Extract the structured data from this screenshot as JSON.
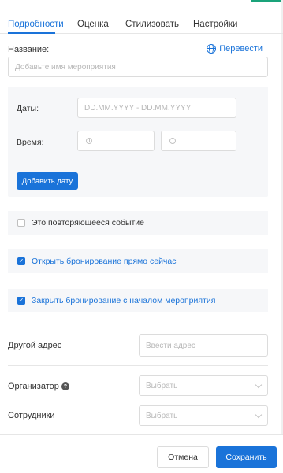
{
  "tabs": [
    {
      "label": "Подробности",
      "active": true
    },
    {
      "label": "Оценка",
      "active": false
    },
    {
      "label": "Стилизовать",
      "active": false
    },
    {
      "label": "Настройки",
      "active": false
    }
  ],
  "name_field": {
    "label": "Название:",
    "placeholder": "Добавьте имя мероприятия",
    "translate_label": "Перевести"
  },
  "dates": {
    "dates_label": "Даты:",
    "dates_placeholder": "DD.MM.YYYY - DD.MM.YYYY",
    "time_label": "Время:",
    "add_date_button": "Добавить дату"
  },
  "options": [
    {
      "label": "Это повторяющееся событие",
      "checked": false
    },
    {
      "label": "Открыть бронирование прямо сейчас",
      "checked": true
    },
    {
      "label": "Закрыть бронирование с началом мероприятия",
      "checked": true
    }
  ],
  "other_address": {
    "label": "Другой адрес",
    "placeholder": "Ввести адрес"
  },
  "organizer": {
    "label": "Организатор",
    "placeholder": "Выбрать"
  },
  "staff": {
    "label": "Сотрудники",
    "placeholder": "Выбрать"
  },
  "footer": {
    "cancel_label": "Отмена",
    "save_label": "Сохранить"
  },
  "colors": {
    "accent": "#1a73d9",
    "panel_bg": "#f6f7f9"
  }
}
